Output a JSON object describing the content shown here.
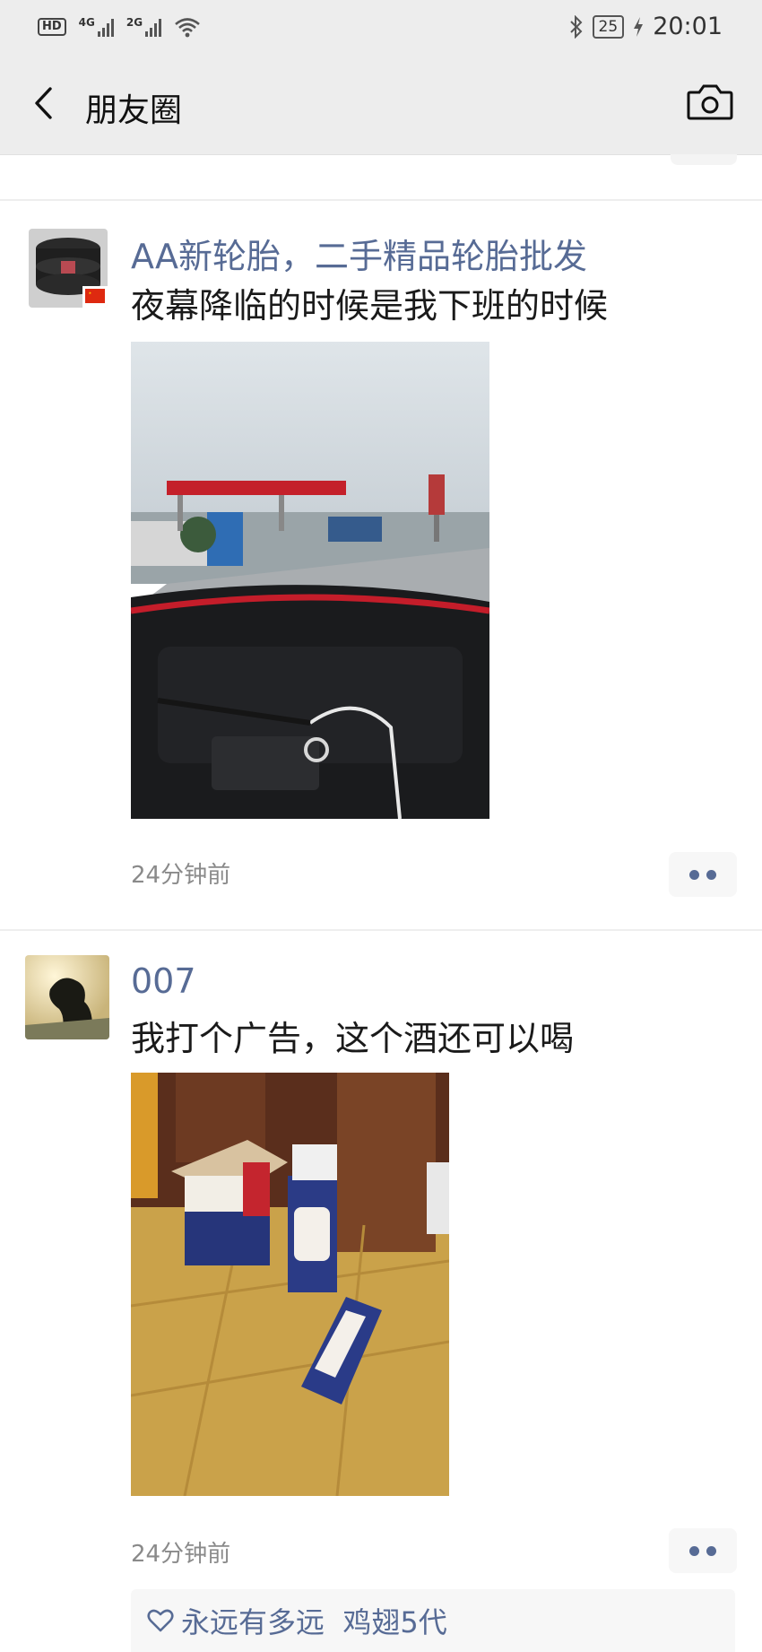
{
  "status_bar": {
    "hd_label": "HD",
    "network_1": "4G",
    "network_2": "2G",
    "battery": "25",
    "time": "20:01"
  },
  "header": {
    "title": "朋友圈",
    "back_icon": "chevron-left-icon",
    "camera_icon": "camera-icon"
  },
  "posts": [
    {
      "author": "AA新轮胎，二手精品轮胎批发",
      "text": "夜幕降临的时候是我下班的时候",
      "time": "24分钟前",
      "photo": "gas-station-from-car-dashboard"
    },
    {
      "author": "007",
      "text": "我打个广告，这个酒还可以喝",
      "time": "24分钟前",
      "photo": "liquor-boxes-on-tiled-floor",
      "likes": "永远有多远  鸡翅5代",
      "like_icon": "heart-outline-icon"
    }
  ],
  "colors": {
    "link": "#576b95",
    "header_bg": "#ededed",
    "time_text": "#8a8a8a"
  }
}
